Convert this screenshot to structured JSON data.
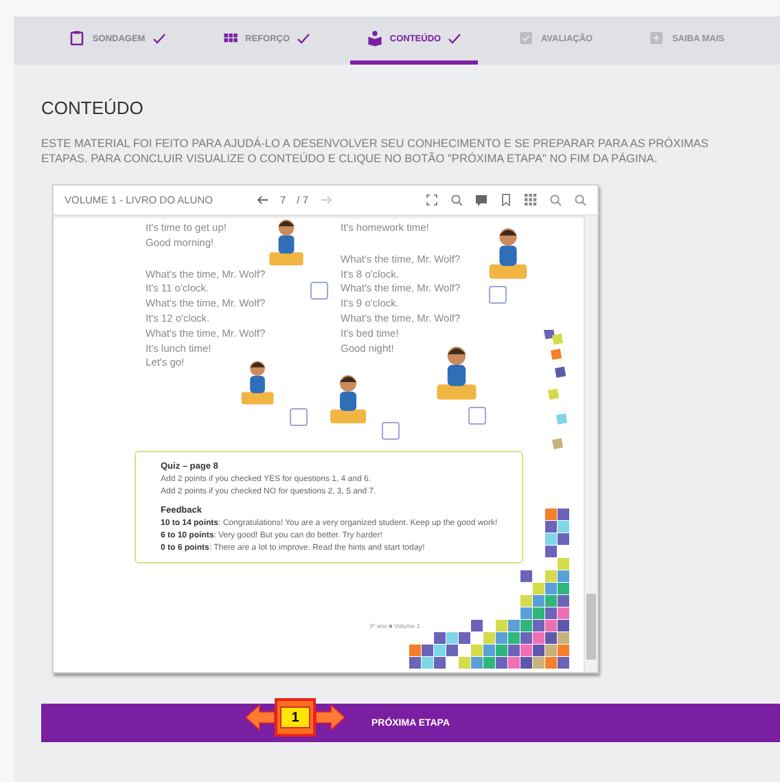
{
  "tabs": [
    {
      "label": "SONDAGEM",
      "completed": true,
      "selected": false
    },
    {
      "label": "REFORÇO",
      "completed": true,
      "selected": false
    },
    {
      "label": "CONTEÚDO",
      "completed": true,
      "selected": true
    },
    {
      "label": "AVALIAÇÃO",
      "completed": false,
      "selected": false
    },
    {
      "label": "SAIBA MAIS",
      "completed": false,
      "selected": false
    }
  ],
  "content": {
    "title": "CONTEÚDO",
    "description": "ESTE MATERIAL FOI FEITO PARA AJUDÁ-LO A DESENVOLVER SEU CONHECIMENTO E SE PREPARAR PARA AS PRÓXIMAS ETAPAS. PARA CONCLUIR VISUALIZE O CONTEÚDO E CLIQUE NO BOTÃO \"PRÓXIMA ETAPA\" NO FIM DA PÁGINA."
  },
  "viewer": {
    "title": "VOLUME 1 - LIVRO DO ALUNO",
    "page": "7",
    "page_count": "/ 7",
    "song_columns": [
      [
        [
          "It's time to get up!",
          "Good morning!"
        ],
        [
          "What's the time, Mr. Wolf?",
          "It's 11 o'clock.",
          "What's the time, Mr. Wolf?",
          "It's 12 o'clock.",
          "What's the time, Mr. Wolf?",
          "It's lunch time!",
          "Let's go!"
        ]
      ],
      [
        [
          "It's homework time!"
        ],
        [
          "What's the time, Mr. Wolf?",
          "It's 8 o'clock.",
          "What's the time, Mr. Wolf?",
          "It's 9 o'clock.",
          "What's the time, Mr. Wolf?",
          "It's bed time!",
          "Good night!"
        ]
      ]
    ],
    "checkboxes": [
      {
        "checked": false
      },
      {
        "checked": false
      },
      {
        "checked": false
      },
      {
        "checked": false
      },
      {
        "checked": false
      }
    ],
    "quiz": {
      "title": "Quiz – page 8",
      "rules": [
        "Add 2 points if you checked YES for questions 1, 4 and 6.",
        "Add 2 points if you checked NO for questions 2, 3, 5 and 7."
      ],
      "feedback_title": "Feedback",
      "feedback": [
        "**10 to 14 points**: Congratulations! You are a very organized student. Keep up the good work!",
        "**6 to 10 points**: Very good! But you can do better. Try harder!",
        "**0 to 6 points**: There are a lot to improve. Read the hints and start today!"
      ]
    },
    "footer": "3º ano ■ Volume 1"
  },
  "next_button": {
    "label": "PRÓXIMA ETAPA"
  },
  "annotation_marker": {
    "label": "1"
  }
}
